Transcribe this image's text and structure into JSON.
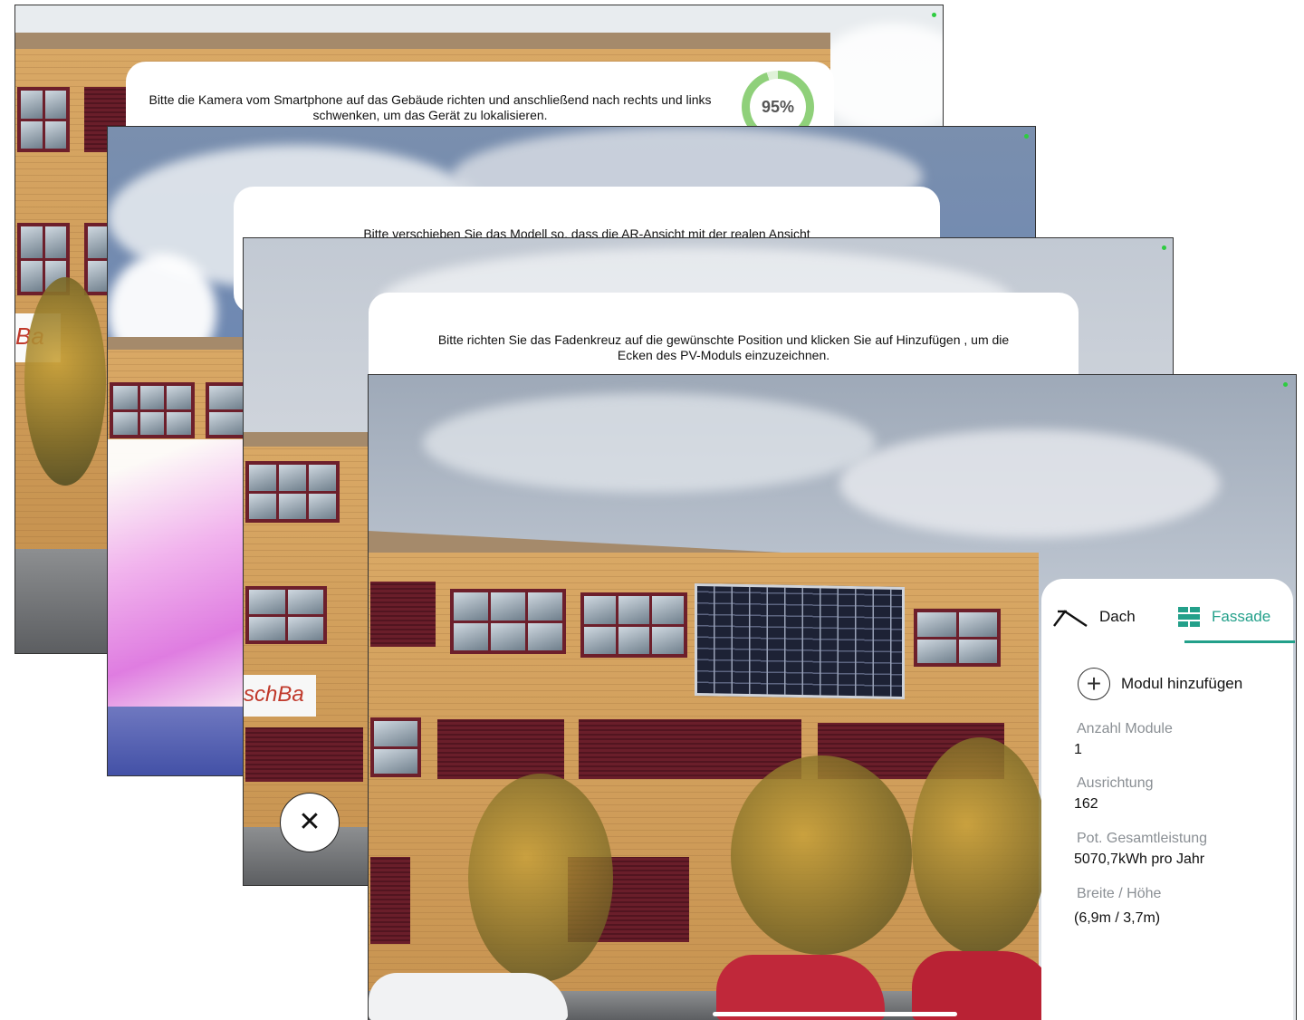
{
  "screen1": {
    "instruction": "Bitte die Kamera vom Smartphone auf das Gebäude richten und anschließend nach rechts und links schwenken, um das Gerät zu lokalisieren.",
    "progress_label": "95%",
    "progress": 0.95,
    "sign_text": "Ba"
  },
  "screen2": {
    "instruction": "Bitte verschieben Sie das Modell so, dass die AR-Ansicht mit der realen Ansicht"
  },
  "screen3": {
    "instruction": "Bitte richten Sie das Fadenkreuz auf die gewünschte Position und klicken Sie auf Hinzufügen , um die Ecken des PV-Moduls einzuzeichnen.",
    "sign_text": "schBa",
    "close_glyph": "✕"
  },
  "screen4": {
    "tabs": [
      {
        "label": "Dach",
        "icon": "roof-icon",
        "active": false
      },
      {
        "label": "Fassade",
        "icon": "facade-icon",
        "active": true
      }
    ],
    "add_module_label": "Modul hinzufügen",
    "fields": [
      {
        "label": "Anzahl Module",
        "value": "1"
      },
      {
        "label": "Ausrichtung",
        "value": "162"
      },
      {
        "label": "Pot. Gesamtleistung",
        "value": "5070,7kWh pro Jahr"
      },
      {
        "label": "Breite / Höhe",
        "value": "(6,9m / 3,7m)"
      }
    ],
    "accent_color": "#23a08a"
  }
}
